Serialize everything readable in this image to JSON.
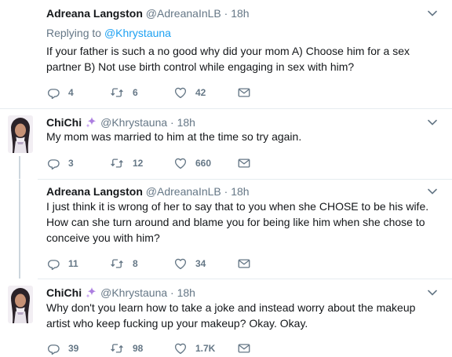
{
  "tweets": [
    {
      "name": "Adreana Langston",
      "handle": "@AdreanaInLB",
      "dot": "·",
      "time": "18h",
      "replying_prefix": "Replying to",
      "replying_to": "@Khrystauna",
      "text": "If your father is such a no good why did your mom A) Choose him for a sex partner B) Not use birth control while engaging in sex with him?",
      "replies": "4",
      "retweets": "6",
      "likes": "42"
    },
    {
      "name": "ChiChi",
      "handle": "@Khrystauna",
      "dot": "·",
      "time": "18h",
      "text": "My mom was married to him at the time so try again.",
      "replies": "3",
      "retweets": "12",
      "likes": "660"
    },
    {
      "name": "Adreana Langston",
      "handle": "@AdreanaInLB",
      "dot": "·",
      "time": "18h",
      "text": "I just think it is wrong of her to say that to you when she CHOSE to be his wife. How can she turn around and blame you for being like him when she chose to conceive you with him?",
      "replies": "11",
      "retweets": "8",
      "likes": "34"
    },
    {
      "name": "ChiChi",
      "handle": "@Khrystauna",
      "dot": "·",
      "time": "18h",
      "text": "Why don't you learn how to take a joke and instead worry about the makeup artist who keep fucking up your makeup? Okay. Okay.",
      "replies": "39",
      "retweets": "98",
      "likes": "1.7K"
    }
  ],
  "colors": {
    "muted": "#657786",
    "link": "#1da1f2",
    "separator": "#e6ecf0",
    "thread_line": "#ccd6dd",
    "sparkle": "#ac7ee0"
  }
}
